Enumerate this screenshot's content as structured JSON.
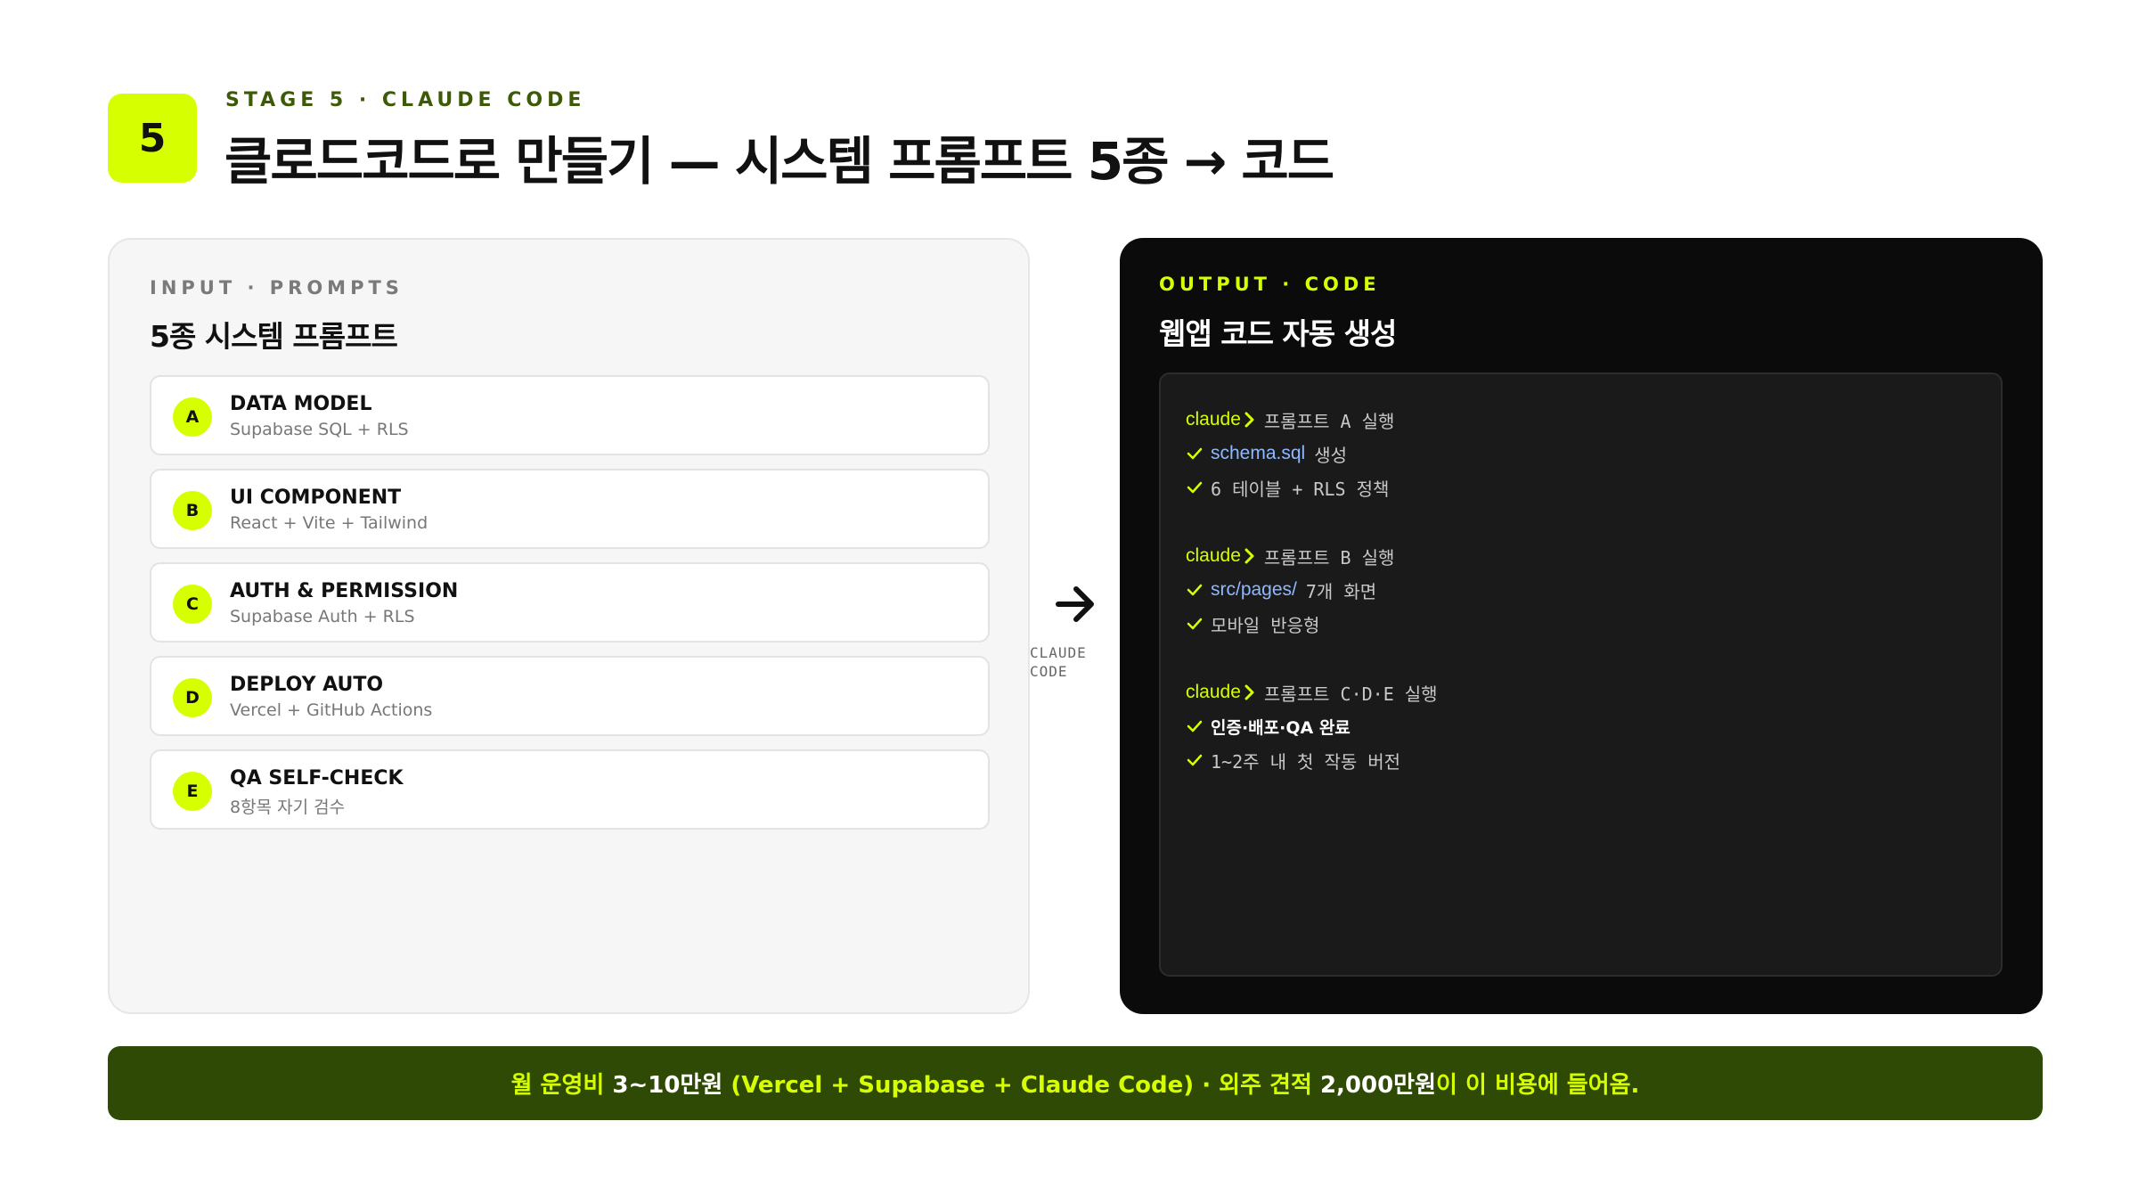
{
  "header": {
    "stage_number": "5",
    "stage_label": "STAGE 5 · CLAUDE CODE",
    "title": "클로드코드로 만들기 — 시스템 프롬프트 5종 → 코드"
  },
  "input_panel": {
    "eyebrow": "INPUT · PROMPTS",
    "heading": "5종 시스템 프롬프트",
    "items": [
      {
        "letter": "A",
        "title": "DATA MODEL",
        "subtitle": "Supabase SQL + RLS"
      },
      {
        "letter": "B",
        "title": "UI COMPONENT",
        "subtitle": "React + Vite + Tailwind"
      },
      {
        "letter": "C",
        "title": "AUTH & PERMISSION",
        "subtitle": "Supabase Auth + RLS"
      },
      {
        "letter": "D",
        "title": "DEPLOY AUTO",
        "subtitle": "Vercel + GitHub Actions"
      },
      {
        "letter": "E",
        "title": "QA SELF-CHECK",
        "subtitle": "8항목 자기 검수"
      }
    ]
  },
  "flow": {
    "label_line1": "CLAUDE",
    "label_line2": "CODE"
  },
  "output_panel": {
    "eyebrow": "OUTPUT · CODE",
    "heading": "웹앱 코드 자동 생성",
    "terminal": {
      "block1": {
        "cmd": "claude",
        "text": "프롬프트 A 실행",
        "line1_path": "schema.sql",
        "line1_text": "생성",
        "line2_text": "6 테이블 + RLS 정책"
      },
      "block2": {
        "cmd": "claude",
        "text": "프롬프트 B 실행",
        "line1_path": "src/pages/",
        "line1_text": "7개 화면",
        "line2_text": "모바일 반응형"
      },
      "block3": {
        "cmd": "claude",
        "text": "프롬프트 C·D·E 실행",
        "line1_text": "인증·배포·QA 완료",
        "line2_text": "1~2주 내 첫 작동 버전"
      }
    }
  },
  "banner": {
    "part1": "월 운영비 ",
    "em1": "3~10만원",
    "part2": " (Vercel + Supabase + Claude Code) · 외주 견적 ",
    "em2": "2,000만원",
    "part3": "이 이 비용에 들어옴."
  },
  "colors": {
    "accent": "#d6ff00",
    "banner_bg": "#2e4a05",
    "dark_panel": "#0b0b0b",
    "path_blue": "#8fb8ff"
  }
}
